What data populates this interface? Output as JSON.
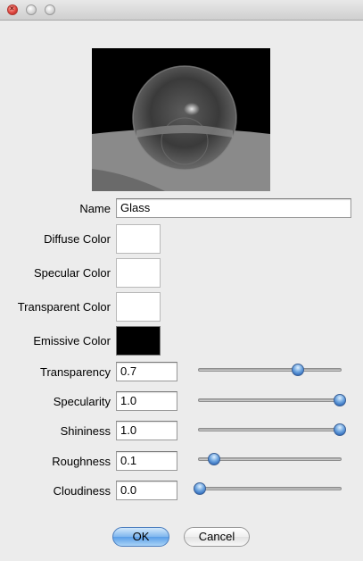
{
  "window": {
    "title": "",
    "controls": [
      "close-icon",
      "minimize-icon",
      "zoom-icon"
    ]
  },
  "preview": {
    "alt": "Material preview sphere",
    "background": "#000000"
  },
  "form": {
    "name_label": "Name",
    "name_value": "Glass",
    "diffuse_label": "Diffuse Color",
    "diffuse_color": "#ffffff",
    "specular_label": "Specular Color",
    "specular_color": "#ffffff",
    "transparent_label": "Transparent Color",
    "transparent_color": "#ffffff",
    "emissive_label": "Emissive Color",
    "emissive_color": "#000000",
    "transparency_label": "Transparency",
    "transparency_value": "0.7",
    "transparency_level": 0.7,
    "specularity_label": "Specularity",
    "specularity_value": "1.0",
    "specularity_level": 1.0,
    "shininess_label": "Shininess",
    "shininess_value": "1.0",
    "shininess_level": 1.0,
    "roughness_label": "Roughness",
    "roughness_value": "0.1",
    "roughness_level": 0.1,
    "cloudiness_label": "Cloudiness",
    "cloudiness_value": "0.0",
    "cloudiness_level": 0.0
  },
  "buttons": {
    "ok_label": "OK",
    "cancel_label": "Cancel"
  },
  "colors": {
    "accent": "#5a9ee8",
    "window_bg": "#ececec"
  }
}
